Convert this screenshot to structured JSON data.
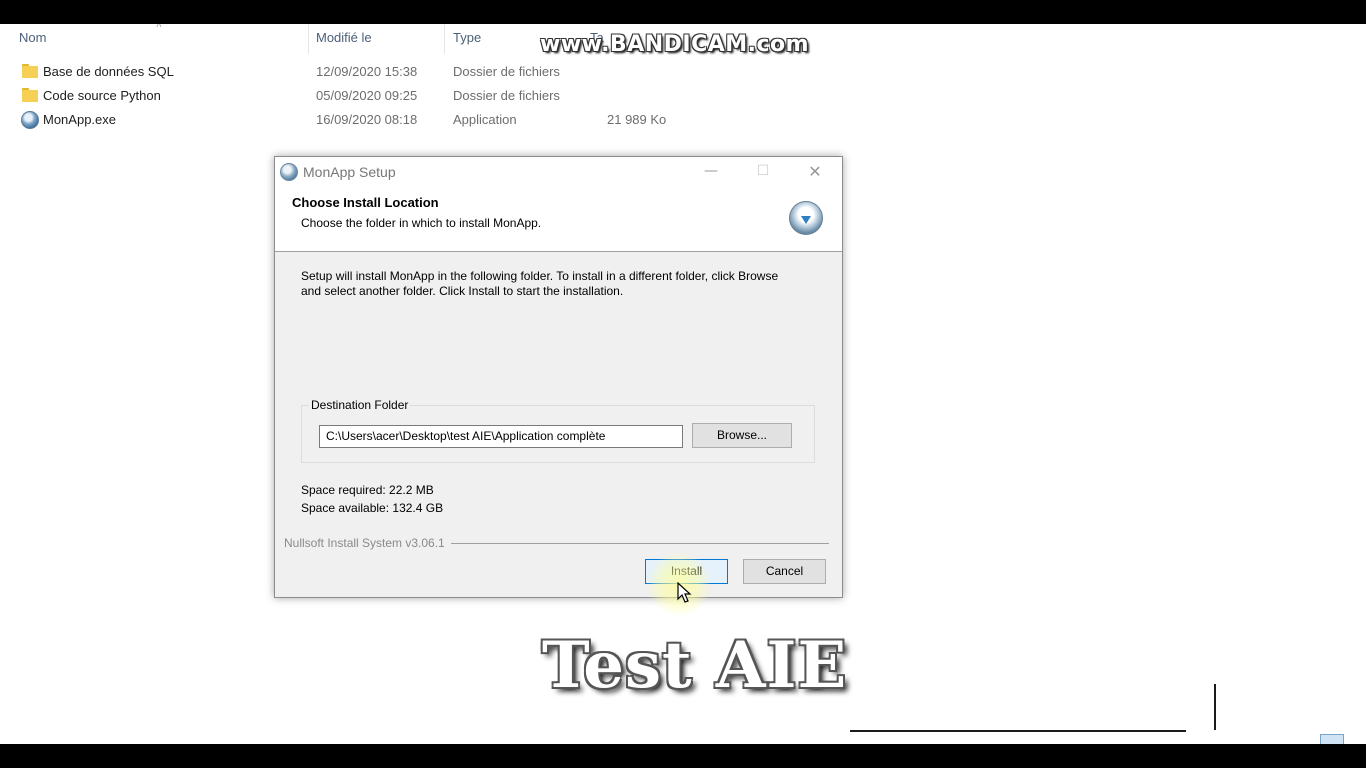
{
  "explorer": {
    "columns": [
      "Nom",
      "Modifié le",
      "Type",
      "Ta"
    ],
    "rows": [
      {
        "name": "Base de données SQL",
        "modified": "12/09/2020 15:38",
        "type": "Dossier de fichiers",
        "size": "",
        "icon": "folder-icon"
      },
      {
        "name": "Code source Python",
        "modified": "05/09/2020 09:25",
        "type": "Dossier de fichiers",
        "size": "",
        "icon": "folder-icon"
      },
      {
        "name": "MonApp.exe",
        "modified": "16/09/2020 08:18",
        "type": "Application",
        "size": "21 989 Ko",
        "icon": "app-icon"
      }
    ]
  },
  "watermark": "www.BANDICAM.com",
  "dialog": {
    "title": "MonApp Setup",
    "minimize": "—",
    "maximize": "☐",
    "close": "✕",
    "header_title": "Choose Install Location",
    "header_subtitle": "Choose the folder in which to install MonApp.",
    "body_line1": "Setup will install MonApp in the following folder. To install in a different folder, click Browse",
    "body_line2": "and select another folder. Click Install to start the installation.",
    "group_label": "Destination Folder",
    "path_value": "C:\\Users\\acer\\Desktop\\test AIE\\Application complète",
    "browse_label": "Browse...",
    "space_required": "Space required: 22.2 MB",
    "space_available": "Space available: 132.4 GB",
    "branding": "Nullsoft Install System v3.06.1",
    "install_label": "Install",
    "cancel_label": "Cancel"
  },
  "caption": "Test AIE",
  "colors": {
    "accent": "#0078d7",
    "folder": "#f7cf55",
    "dialog_bg": "#f0f0f0"
  }
}
